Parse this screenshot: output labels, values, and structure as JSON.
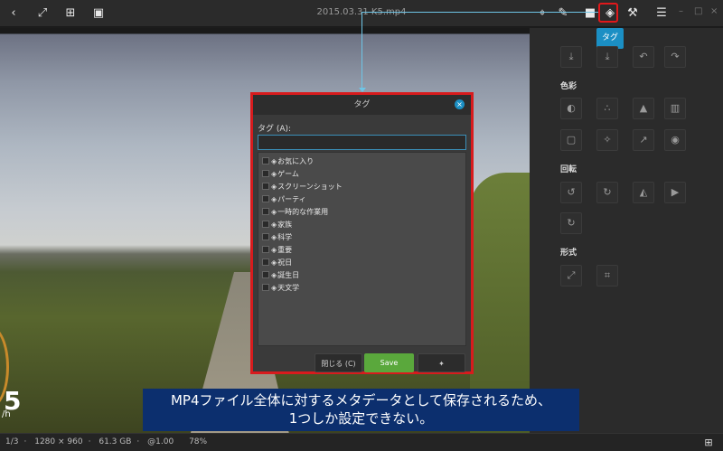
{
  "window": {
    "title": "2015.03.31 K5.mp4",
    "icons": [
      "back-icon",
      "fullscreen-icon",
      "collage-icon",
      "camera-icon",
      "map-pin-icon",
      "draw-icon",
      "comment-icon",
      "tag-icon",
      "wrench-icon",
      "menu-icon"
    ],
    "controls": {
      "minimize": "–",
      "maximize": "□",
      "close": "×"
    }
  },
  "panel": {
    "tooltip": "タグ",
    "sections": {
      "color": "色彩",
      "rotate": "回転",
      "format": "形式"
    }
  },
  "dialog": {
    "title": "タグ",
    "tag_label": "タグ (A):",
    "tag_input_value": "",
    "tags": [
      "お気に入り",
      "ゲーム",
      "スクリーンショット",
      "パーティ",
      "一時的な作業用",
      "家族",
      "科学",
      "重要",
      "祝日",
      "誕生日",
      "天文学"
    ],
    "close_button": "閉じる (C)",
    "save_button": "Save"
  },
  "caption": {
    "line1": "MP4ファイル全体に対するメタデータとして保存されるため、",
    "line2": "1つしか設定できない。"
  },
  "video_overlay": {
    "speed": "5",
    "unit": "/h"
  },
  "status": {
    "position": "1/3",
    "dimensions": "1280 × 960",
    "size": "61.3 GB",
    "zoom_ratio": "@1.00",
    "zoom": "78%"
  },
  "colors": {
    "accent": "#1b8fc4",
    "highlight": "#e0181b",
    "save": "#5aa83c",
    "caption_bg": "#0c2f6e"
  }
}
